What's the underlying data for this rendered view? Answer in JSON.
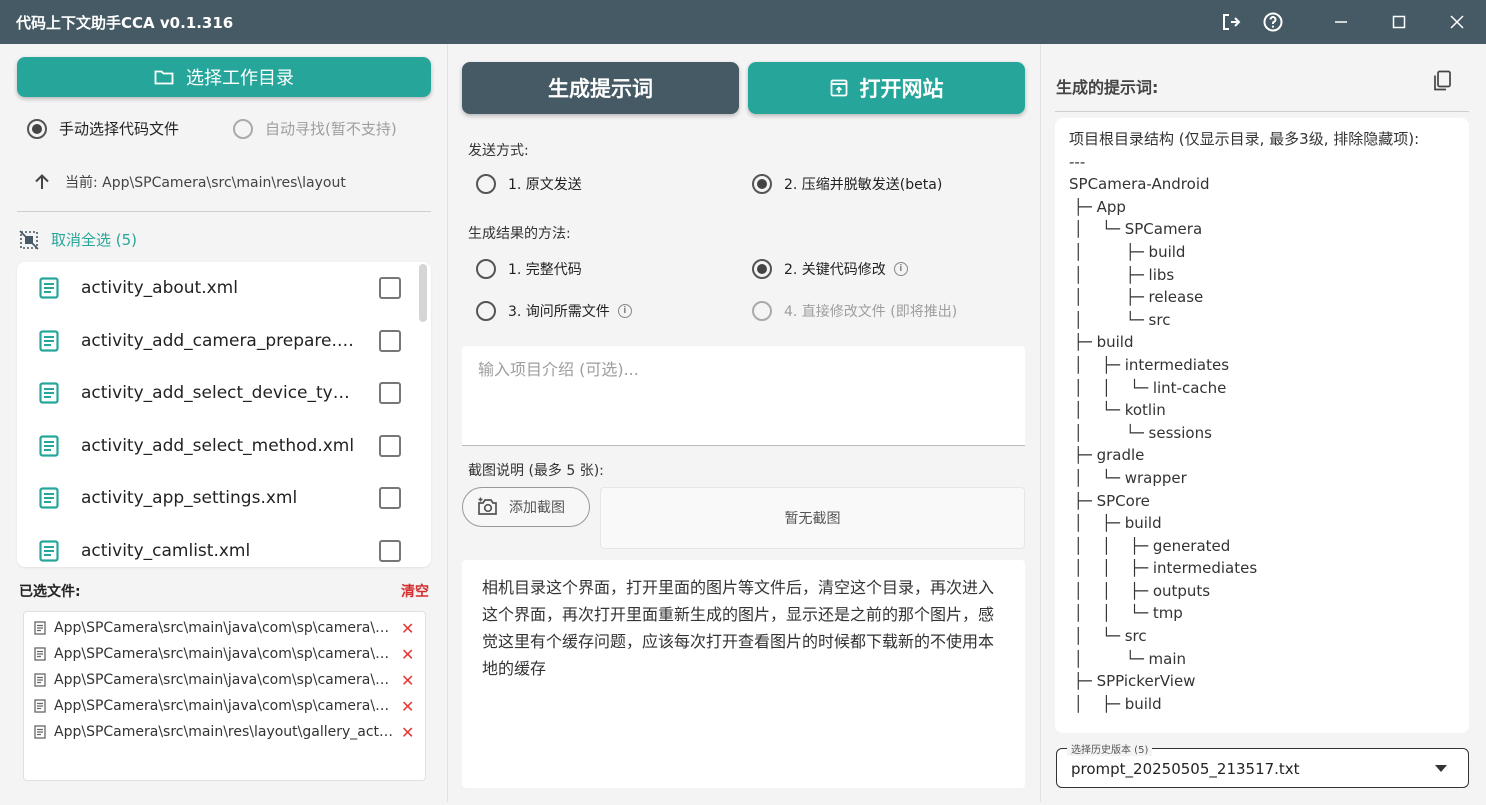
{
  "window": {
    "title": "代码上下文助手CCA v0.1.316"
  },
  "left": {
    "choose_dir_label": "选择工作目录",
    "mode_manual": "手动选择代码文件",
    "mode_auto": "自动寻找(暂不支持)",
    "current_path": "当前: App\\SPCamera\\src\\main\\res\\layout",
    "deselect_all": "取消全选 (5)",
    "files": [
      {
        "name": "activity_about.xml"
      },
      {
        "name": "activity_add_camera_prepare.xml"
      },
      {
        "name": "activity_add_select_device_type.xml"
      },
      {
        "name": "activity_add_select_method.xml"
      },
      {
        "name": "activity_app_settings.xml"
      },
      {
        "name": "activity_camlist.xml"
      }
    ],
    "selected_label": "已选文件:",
    "clear_label": "清空",
    "selected_files": [
      {
        "path": "App\\SPCamera\\src\\main\\java\\com\\sp\\camera\\ui\\gallery\\GalleryActivity.java"
      },
      {
        "path": "App\\SPCamera\\src\\main\\java\\com\\sp\\camera\\ui\\gallery\\GalleryAdapter.java"
      },
      {
        "path": "App\\SPCamera\\src\\main\\java\\com\\sp\\camera\\ui\\gallery\\ImageViewer.java"
      },
      {
        "path": "App\\SPCamera\\src\\main\\java\\com\\sp\\camera\\ui\\gallery\\FileCache.java"
      },
      {
        "path": "App\\SPCamera\\src\\main\\res\\layout\\gallery_activity.xml"
      }
    ]
  },
  "middle": {
    "generate_label": "生成提示词",
    "open_site_label": "打开网站",
    "send_mode_label": "发送方式:",
    "send_opt1": "1. 原文发送",
    "send_opt2": "2. 压缩并脱敏发送(beta)",
    "result_label": "生成结果的方法:",
    "result_opt1": "1. 完整代码",
    "result_opt2": "2. 关键代码修改",
    "result_opt3": "3. 询问所需文件",
    "result_opt4": "4. 直接修改文件 (即将推出)",
    "intro_placeholder": "输入项目介绍 (可选)...",
    "screenshot_label": "截图说明 (最多 5 张):",
    "add_screenshot": "添加截图",
    "no_screenshot": "暂无截图",
    "description": "相机目录这个界面，打开里面的图片等文件后，清空这个目录，再次进入这个界面，再次打开里面重新生成的图片，显示还是之前的那个图片，感觉这里有个缓存问题，应该每次打开查看图片的时候都下载新的不使用本地的缓存"
  },
  "right": {
    "title": "生成的提示词:",
    "prompt_text": "项目根目录结构 (仅显示目录, 最多3级, 排除隐藏项):\n---\nSPCamera-Android\n ├─ App\n │    └─ SPCamera\n │         ├─ build\n │         ├─ libs\n │         ├─ release\n │         └─ src\n ├─ build\n │    ├─ intermediates\n │    │    └─ lint-cache\n │    └─ kotlin\n │         └─ sessions\n ├─ gradle\n │    └─ wrapper\n ├─ SPCore\n │    ├─ build\n │    │    ├─ generated\n │    │    ├─ intermediates\n │    │    ├─ outputs\n │    │    └─ tmp\n │    └─ src\n │         └─ main\n ├─ SPPickerView\n │    ├─ build",
    "history_label": "选择历史版本 (5)",
    "history_value": "prompt_20250505_213517.txt"
  }
}
